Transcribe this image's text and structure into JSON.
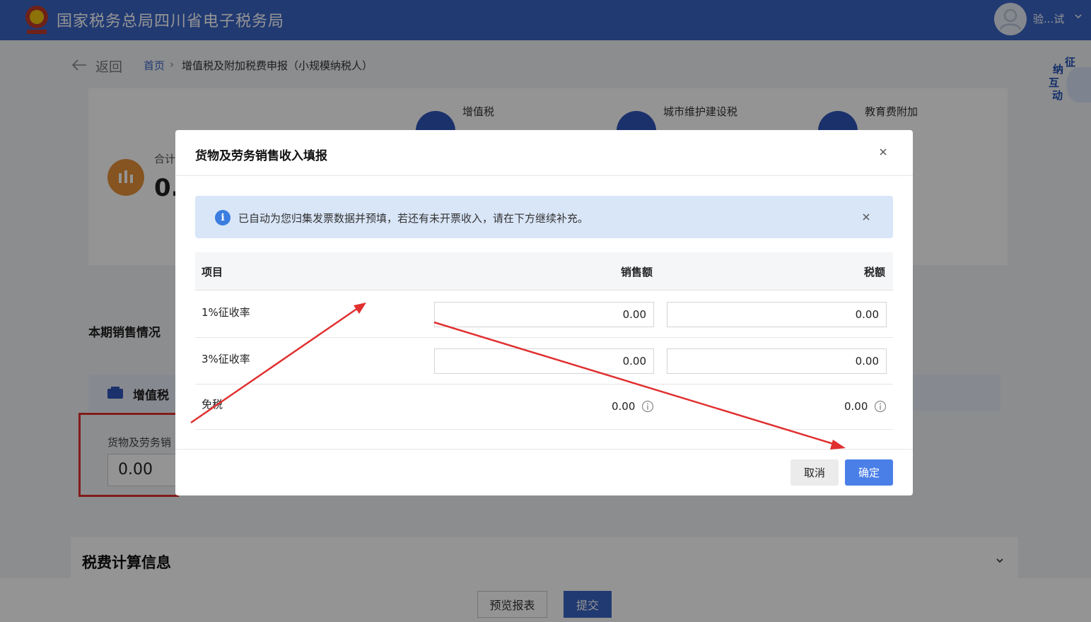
{
  "header": {
    "title": "国家税务总局四川省电子税务局",
    "username": "验...试",
    "logo_icon": "tax-emblem-icon",
    "background_color": "#3a64c4"
  },
  "nav": {
    "back_label": "返回",
    "breadcrumb": {
      "home": "首页",
      "separator": "›",
      "current": "增值税及附加税费申报（小规模纳税人）"
    }
  },
  "summary": {
    "total_label": "合计",
    "total_value": "0.",
    "taxes": [
      {
        "label": "增值税",
        "icon": "tax-document-icon"
      },
      {
        "label": "城市维护建设税",
        "icon": "city-tax-icon"
      },
      {
        "label": "教育费附加",
        "icon": "education-cap-icon"
      }
    ]
  },
  "sales": {
    "section_title": "本期销售情况",
    "vat_label": "增值税",
    "goods_label": "货物及劳务销",
    "goods_value": "0.00"
  },
  "calc": {
    "title": "税费计算信息"
  },
  "mascot": {
    "chars": [
      "征",
      "纳",
      "互",
      "动"
    ]
  },
  "footer": {
    "preview_label": "预览报表",
    "submit_label": "提交"
  },
  "modal": {
    "title": "货物及劳务销售收入填报",
    "alert_text": "已自动为您归集发票数据并预填，若还有未开票收入，请在下方继续补充。",
    "columns": {
      "item": "项目",
      "sales": "销售额",
      "tax": "税额"
    },
    "rows": [
      {
        "label": "1%征收率",
        "sales": "0.00",
        "tax": "0.00"
      },
      {
        "label": "3%征收率",
        "sales": "0.00",
        "tax": "0.00"
      },
      {
        "label": "免税",
        "sales": "0.00",
        "tax": "0.00"
      }
    ],
    "cancel_label": "取消",
    "ok_label": "确定",
    "accent_color": "#4a7fe8",
    "annotation_color": "#e03030"
  }
}
